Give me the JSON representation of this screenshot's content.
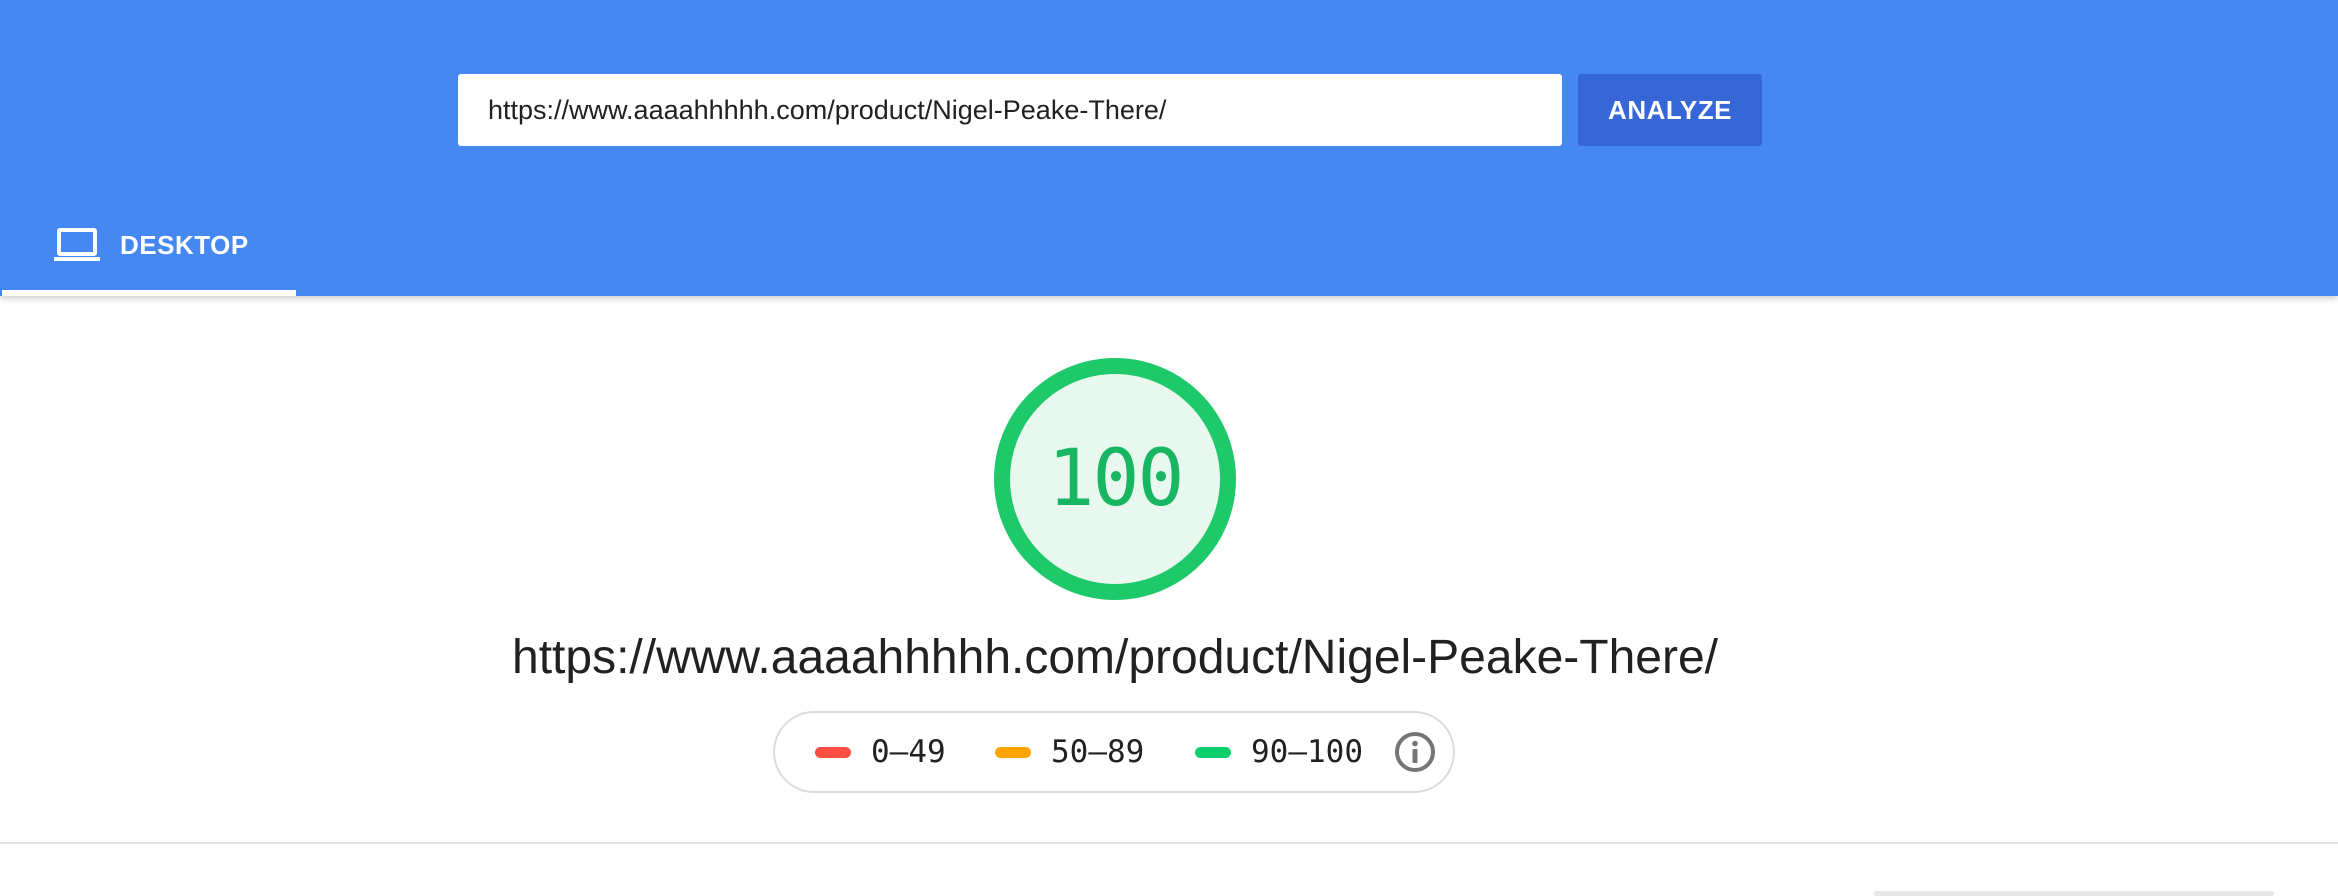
{
  "search": {
    "url_value": "https://www.aaaahhhhh.com/product/Nigel-Peake-There/",
    "analyze_label": "ANALYZE"
  },
  "tabs": [
    {
      "label": "DESKTOP",
      "icon": "laptop-icon",
      "selected": true
    }
  ],
  "report": {
    "score": "100",
    "audited_url": "https://www.aaaahhhhh.com/product/Nigel-Peake-There/",
    "score_fraction": 1.0,
    "score_color": "#0cce6b"
  },
  "legend": [
    {
      "label": "0–49",
      "color": "#ff4e42"
    },
    {
      "label": "50–89",
      "color": "#ffa400"
    },
    {
      "label": "90–100",
      "color": "#0cce6b"
    }
  ],
  "colors": {
    "header_bg": "#4688f1",
    "button_bg": "#3766d6"
  }
}
